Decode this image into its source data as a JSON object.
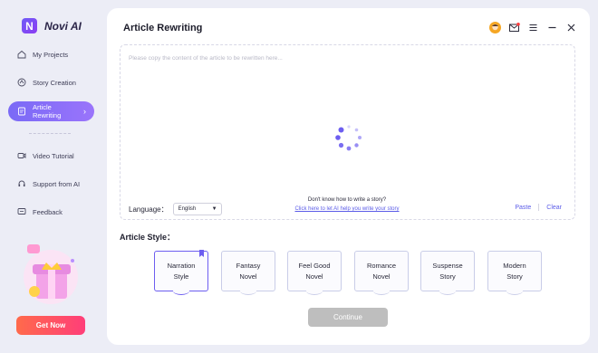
{
  "brand": {
    "name": "Novi AI",
    "logo_letter": "N"
  },
  "sidebar": {
    "items": [
      {
        "label": "My Projects",
        "icon": "home-icon"
      },
      {
        "label": "Story Creation",
        "icon": "story-icon"
      },
      {
        "label": "Article Rewriting",
        "icon": "document-icon",
        "active": true
      },
      {
        "label": "Video Tutorial",
        "icon": "video-icon"
      },
      {
        "label": "Support from AI",
        "icon": "headset-icon"
      },
      {
        "label": "Feedback",
        "icon": "feedback-icon"
      }
    ],
    "active_chevron": "›",
    "cta_label": "Get Now"
  },
  "header": {
    "title": "Article Rewriting"
  },
  "editor": {
    "placeholder": "Please copy the content of the article to be rewritten here...",
    "language_label": "Language：",
    "language_value": "English",
    "help_question": "Don't know how to write a story?",
    "help_link": "Click here to let AI help you write your story",
    "paste_label": "Paste",
    "clear_label": "Clear"
  },
  "styles": {
    "label": "Article Style：",
    "cards": [
      {
        "line1": "Narration",
        "line2": "Style",
        "active": true
      },
      {
        "line1": "Fantasy",
        "line2": "Novel"
      },
      {
        "line1": "Feel Good",
        "line2": "Novel"
      },
      {
        "line1": "Romance",
        "line2": "Novel"
      },
      {
        "line1": "Suspense",
        "line2": "Story"
      },
      {
        "line1": "Modern",
        "line2": "Story"
      }
    ]
  },
  "continue_label": "Continue",
  "colors": {
    "accent": "#6d5ef0",
    "cta_start": "#ff6a4b",
    "cta_end": "#ff3e79",
    "disabled": "#bebebe"
  }
}
